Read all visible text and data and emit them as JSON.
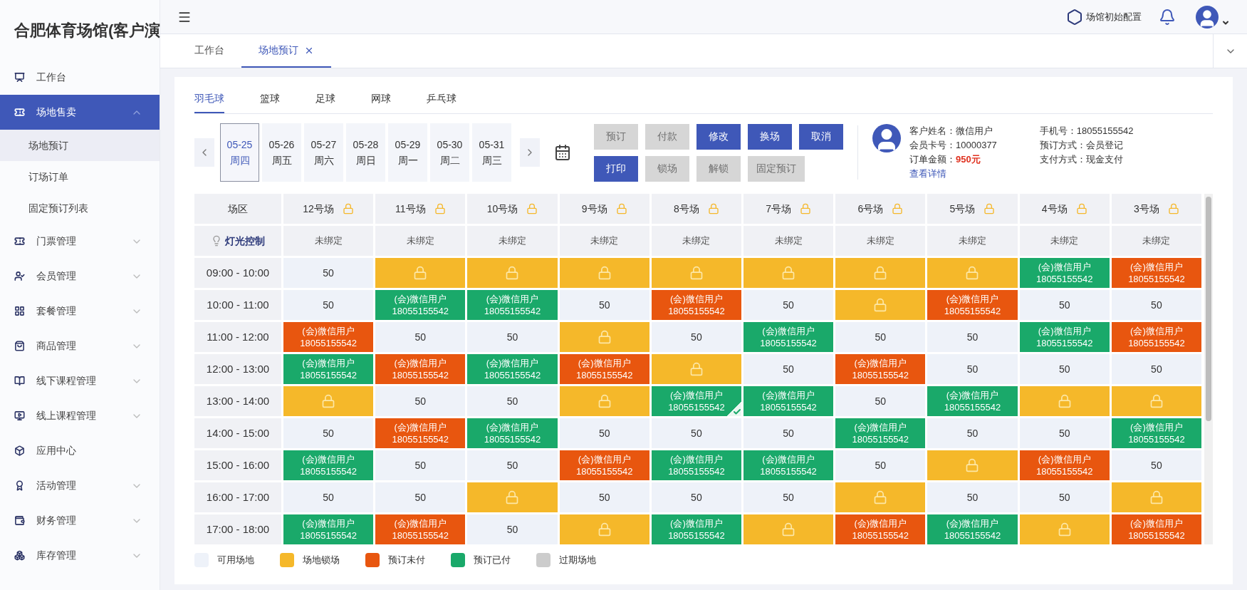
{
  "app": {
    "title": "合肥体育场馆(客户演"
  },
  "sidebar": {
    "items": [
      {
        "kind": "link",
        "label": "工作台",
        "selected": false
      },
      {
        "kind": "group",
        "label": "场地售卖",
        "selected": true,
        "expanded": true,
        "children": [
          {
            "label": "场地预订",
            "selected": true
          },
          {
            "label": "订场订单",
            "selected": false
          },
          {
            "label": "固定预订列表",
            "selected": false
          }
        ]
      },
      {
        "kind": "group",
        "label": "门票管理",
        "selected": false,
        "expanded": false
      },
      {
        "kind": "group",
        "label": "会员管理",
        "selected": false,
        "expanded": false
      },
      {
        "kind": "group",
        "label": "套餐管理",
        "selected": false,
        "expanded": false
      },
      {
        "kind": "group",
        "label": "商品管理",
        "selected": false,
        "expanded": false
      },
      {
        "kind": "group",
        "label": "线下课程管理",
        "selected": false,
        "expanded": false
      },
      {
        "kind": "group",
        "label": "线上课程管理",
        "selected": false,
        "expanded": false
      },
      {
        "kind": "link",
        "label": "应用中心",
        "selected": false
      },
      {
        "kind": "group",
        "label": "活动管理",
        "selected": false,
        "expanded": false
      },
      {
        "kind": "group",
        "label": "财务管理",
        "selected": false,
        "expanded": false
      },
      {
        "kind": "group",
        "label": "库存管理",
        "selected": false,
        "expanded": false
      }
    ]
  },
  "header": {
    "config_label": "场馆初始配置"
  },
  "page_tabs": [
    {
      "label": "工作台",
      "selected": false,
      "closable": false
    },
    {
      "label": "场地预订",
      "selected": true,
      "closable": true
    }
  ],
  "sport_tabs": [
    {
      "label": "羽毛球",
      "selected": true
    },
    {
      "label": "篮球",
      "selected": false
    },
    {
      "label": "足球",
      "selected": false
    },
    {
      "label": "网球",
      "selected": false
    },
    {
      "label": "乒乓球",
      "selected": false
    }
  ],
  "dates": [
    {
      "date": "05-25",
      "weekday": "周四",
      "selected": true
    },
    {
      "date": "05-26",
      "weekday": "周五",
      "selected": false
    },
    {
      "date": "05-27",
      "weekday": "周六",
      "selected": false
    },
    {
      "date": "05-28",
      "weekday": "周日",
      "selected": false
    },
    {
      "date": "05-29",
      "weekday": "周一",
      "selected": false
    },
    {
      "date": "05-30",
      "weekday": "周二",
      "selected": false
    },
    {
      "date": "05-31",
      "weekday": "周三",
      "selected": false
    }
  ],
  "action_rows": [
    [
      {
        "label": "预订",
        "disabled": true
      },
      {
        "label": "付款",
        "disabled": true
      },
      {
        "label": "修改",
        "disabled": false
      },
      {
        "label": "换场",
        "disabled": false
      },
      {
        "label": "取消",
        "disabled": false
      }
    ],
    [
      {
        "label": "打印",
        "disabled": false
      },
      {
        "label": "锁场",
        "disabled": true
      },
      {
        "label": "解锁",
        "disabled": true
      },
      {
        "label": "固定预订",
        "disabled": true
      }
    ]
  ],
  "customer": {
    "left": [
      {
        "label": "客户姓名：",
        "value": "微信用户",
        "kind": "text"
      },
      {
        "label": "会员卡号：",
        "value": "10000377",
        "kind": "text"
      },
      {
        "label": "订单金额：",
        "value": "950元",
        "kind": "amount"
      }
    ],
    "right": [
      {
        "label": "手机号：",
        "value": "18055155542",
        "kind": "text"
      },
      {
        "label": "预订方式：",
        "value": "会员登记",
        "kind": "text"
      },
      {
        "label": "支付方式：",
        "value": "现金支付",
        "kind": "text"
      }
    ],
    "link": "查看详情"
  },
  "grid": {
    "corner": "场区",
    "courts": [
      "12号场",
      "11号场",
      "10号场",
      "9号场",
      "8号场",
      "7号场",
      "6号场",
      "5号场",
      "4号场",
      "3号场"
    ],
    "light": {
      "label": "灯光控制",
      "cells": [
        "未绑定",
        "未绑定",
        "未绑定",
        "未绑定",
        "未绑定",
        "未绑定",
        "未绑定",
        "未绑定",
        "未绑定",
        "未绑定"
      ]
    },
    "rows": [
      {
        "time": "09:00 - 10:00",
        "cells": [
          {
            "kind": "free",
            "text": "50",
            "selected": false
          },
          {
            "kind": "locked",
            "selected": false
          },
          {
            "kind": "locked",
            "selected": false
          },
          {
            "kind": "locked",
            "selected": false
          },
          {
            "kind": "locked",
            "selected": false
          },
          {
            "kind": "locked",
            "selected": false
          },
          {
            "kind": "locked",
            "selected": false
          },
          {
            "kind": "locked",
            "selected": false
          },
          {
            "kind": "paid",
            "name": "(会)微信用户",
            "phone": "18055155542",
            "selected": false
          },
          {
            "kind": "unpaid",
            "name": "(会)微信用户",
            "phone": "18055155542",
            "selected": false
          }
        ]
      },
      {
        "time": "10:00 - 11:00",
        "cells": [
          {
            "kind": "free",
            "text": "50",
            "selected": false
          },
          {
            "kind": "paid",
            "name": "(会)微信用户",
            "phone": "18055155542",
            "selected": false
          },
          {
            "kind": "paid",
            "name": "(会)微信用户",
            "phone": "18055155542",
            "selected": false
          },
          {
            "kind": "free",
            "text": "50",
            "selected": false
          },
          {
            "kind": "unpaid",
            "name": "(会)微信用户",
            "phone": "18055155542",
            "selected": false
          },
          {
            "kind": "free",
            "text": "50",
            "selected": false
          },
          {
            "kind": "locked",
            "selected": false
          },
          {
            "kind": "unpaid",
            "name": "(会)微信用户",
            "phone": "18055155542",
            "selected": false
          },
          {
            "kind": "free",
            "text": "50",
            "selected": false
          },
          {
            "kind": "free",
            "text": "50",
            "selected": false
          }
        ]
      },
      {
        "time": "11:00 - 12:00",
        "cells": [
          {
            "kind": "unpaid",
            "name": "(会)微信用户",
            "phone": "18055155542",
            "selected": false
          },
          {
            "kind": "free",
            "text": "50",
            "selected": false
          },
          {
            "kind": "free",
            "text": "50",
            "selected": false
          },
          {
            "kind": "locked",
            "selected": false
          },
          {
            "kind": "free",
            "text": "50",
            "selected": false
          },
          {
            "kind": "paid",
            "name": "(会)微信用户",
            "phone": "18055155542",
            "selected": false
          },
          {
            "kind": "free",
            "text": "50",
            "selected": false
          },
          {
            "kind": "free",
            "text": "50",
            "selected": false
          },
          {
            "kind": "paid",
            "name": "(会)微信用户",
            "phone": "18055155542",
            "selected": false
          },
          {
            "kind": "unpaid",
            "name": "(会)微信用户",
            "phone": "18055155542",
            "selected": false
          }
        ]
      },
      {
        "time": "12:00 - 13:00",
        "cells": [
          {
            "kind": "paid",
            "name": "(会)微信用户",
            "phone": "18055155542",
            "selected": false
          },
          {
            "kind": "unpaid",
            "name": "(会)微信用户",
            "phone": "18055155542",
            "selected": false
          },
          {
            "kind": "paid",
            "name": "(会)微信用户",
            "phone": "18055155542",
            "selected": false
          },
          {
            "kind": "unpaid",
            "name": "(会)微信用户",
            "phone": "18055155542",
            "selected": false
          },
          {
            "kind": "locked",
            "selected": false
          },
          {
            "kind": "free",
            "text": "50",
            "selected": false
          },
          {
            "kind": "unpaid",
            "name": "(会)微信用户",
            "phone": "18055155542",
            "selected": false
          },
          {
            "kind": "free",
            "text": "50",
            "selected": false
          },
          {
            "kind": "free",
            "text": "50",
            "selected": false
          },
          {
            "kind": "free",
            "text": "50",
            "selected": false
          }
        ]
      },
      {
        "time": "13:00 - 14:00",
        "cells": [
          {
            "kind": "locked",
            "selected": false
          },
          {
            "kind": "free",
            "text": "50",
            "selected": false
          },
          {
            "kind": "free",
            "text": "50",
            "selected": false
          },
          {
            "kind": "locked",
            "selected": false
          },
          {
            "kind": "paid",
            "name": "(会)微信用户",
            "phone": "18055155542",
            "selected": true
          },
          {
            "kind": "paid",
            "name": "(会)微信用户",
            "phone": "18055155542",
            "selected": false
          },
          {
            "kind": "free",
            "text": "50",
            "selected": false
          },
          {
            "kind": "paid",
            "name": "(会)微信用户",
            "phone": "18055155542",
            "selected": false
          },
          {
            "kind": "locked",
            "selected": false
          },
          {
            "kind": "locked",
            "selected": false
          }
        ]
      },
      {
        "time": "14:00 - 15:00",
        "cells": [
          {
            "kind": "free",
            "text": "50",
            "selected": false
          },
          {
            "kind": "unpaid",
            "name": "(会)微信用户",
            "phone": "18055155542",
            "selected": false
          },
          {
            "kind": "paid",
            "name": "(会)微信用户",
            "phone": "18055155542",
            "selected": false
          },
          {
            "kind": "free",
            "text": "50",
            "selected": false
          },
          {
            "kind": "free",
            "text": "50",
            "selected": false
          },
          {
            "kind": "free",
            "text": "50",
            "selected": false
          },
          {
            "kind": "paid",
            "name": "(会)微信用户",
            "phone": "18055155542",
            "selected": false
          },
          {
            "kind": "free",
            "text": "50",
            "selected": false
          },
          {
            "kind": "free",
            "text": "50",
            "selected": false
          },
          {
            "kind": "paid",
            "name": "(会)微信用户",
            "phone": "18055155542",
            "selected": false
          }
        ]
      },
      {
        "time": "15:00 - 16:00",
        "cells": [
          {
            "kind": "paid",
            "name": "(会)微信用户",
            "phone": "18055155542",
            "selected": false
          },
          {
            "kind": "free",
            "text": "50",
            "selected": false
          },
          {
            "kind": "free",
            "text": "50",
            "selected": false
          },
          {
            "kind": "unpaid",
            "name": "(会)微信用户",
            "phone": "18055155542",
            "selected": false
          },
          {
            "kind": "paid",
            "name": "(会)微信用户",
            "phone": "18055155542",
            "selected": false
          },
          {
            "kind": "paid",
            "name": "(会)微信用户",
            "phone": "18055155542",
            "selected": false
          },
          {
            "kind": "free",
            "text": "50",
            "selected": false
          },
          {
            "kind": "locked",
            "selected": false
          },
          {
            "kind": "unpaid",
            "name": "(会)微信用户",
            "phone": "18055155542",
            "selected": false
          },
          {
            "kind": "free",
            "text": "50",
            "selected": false
          }
        ]
      },
      {
        "time": "16:00 - 17:00",
        "cells": [
          {
            "kind": "free",
            "text": "50",
            "selected": false
          },
          {
            "kind": "free",
            "text": "50",
            "selected": false
          },
          {
            "kind": "locked",
            "selected": false
          },
          {
            "kind": "free",
            "text": "50",
            "selected": false
          },
          {
            "kind": "free",
            "text": "50",
            "selected": false
          },
          {
            "kind": "free",
            "text": "50",
            "selected": false
          },
          {
            "kind": "locked",
            "selected": false
          },
          {
            "kind": "free",
            "text": "50",
            "selected": false
          },
          {
            "kind": "free",
            "text": "50",
            "selected": false
          },
          {
            "kind": "locked",
            "selected": false
          }
        ]
      },
      {
        "time": "17:00 - 18:00",
        "cells": [
          {
            "kind": "paid",
            "name": "(会)微信用户",
            "phone": "18055155542",
            "selected": false
          },
          {
            "kind": "unpaid",
            "name": "(会)微信用户",
            "phone": "18055155542",
            "selected": false
          },
          {
            "kind": "free",
            "text": "50",
            "selected": false
          },
          {
            "kind": "locked",
            "selected": false
          },
          {
            "kind": "paid",
            "name": "(会)微信用户",
            "phone": "18055155542",
            "selected": false
          },
          {
            "kind": "locked",
            "selected": false
          },
          {
            "kind": "unpaid",
            "name": "(会)微信用户",
            "phone": "18055155542",
            "selected": false
          },
          {
            "kind": "paid",
            "name": "(会)微信用户",
            "phone": "18055155542",
            "selected": false
          },
          {
            "kind": "locked",
            "selected": false
          },
          {
            "kind": "unpaid",
            "name": "(会)微信用户",
            "phone": "18055155542",
            "selected": false
          }
        ]
      }
    ]
  },
  "legend": [
    {
      "kind": "free",
      "label": "可用场地",
      "color": "#eef2f9"
    },
    {
      "kind": "locked",
      "label": "场地锁场",
      "color": "#f5b82a"
    },
    {
      "kind": "unpaid",
      "label": "预订未付",
      "color": "#e8560f"
    },
    {
      "kind": "paid",
      "label": "预订已付",
      "color": "#1aa96a"
    },
    {
      "kind": "expired",
      "label": "过期场地",
      "color": "#cccccc"
    }
  ]
}
